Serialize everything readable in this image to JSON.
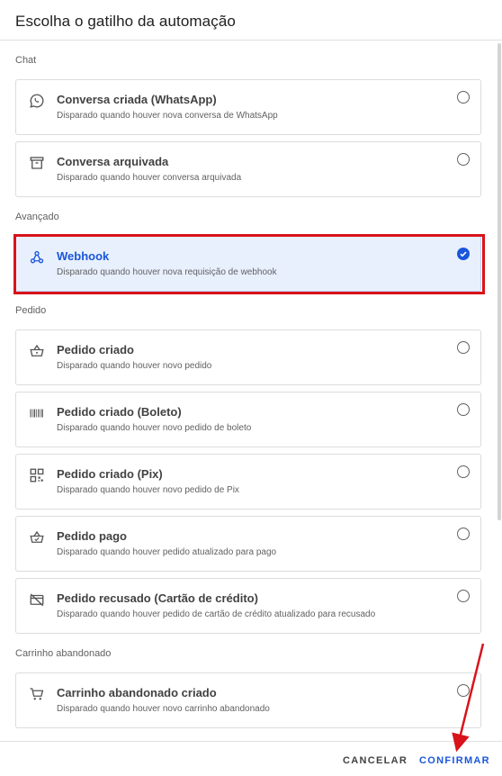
{
  "dialog": {
    "title": "Escolha o gatilho da automação",
    "sections": [
      {
        "label": "Chat",
        "items": [
          {
            "title": "Conversa criada (WhatsApp)",
            "description": "Disparado quando houver nova conversa de WhatsApp",
            "icon": "whatsapp-icon",
            "selected": false
          },
          {
            "title": "Conversa arquivada",
            "description": "Disparado quando houver conversa arquivada",
            "icon": "archive-icon",
            "selected": false
          }
        ]
      },
      {
        "label": "Avançado",
        "items": [
          {
            "title": "Webhook",
            "description": "Disparado quando houver nova requisição de webhook",
            "icon": "webhook-icon",
            "selected": true
          }
        ]
      },
      {
        "label": "Pedido",
        "items": [
          {
            "title": "Pedido criado",
            "description": "Disparado quando houver novo pedido",
            "icon": "basket-icon",
            "selected": false
          },
          {
            "title": "Pedido criado (Boleto)",
            "description": "Disparado quando houver novo pedido de boleto",
            "icon": "barcode-icon",
            "selected": false
          },
          {
            "title": "Pedido criado (Pix)",
            "description": "Disparado quando houver novo pedido de Pix",
            "icon": "qrcode-icon",
            "selected": false
          },
          {
            "title": "Pedido pago",
            "description": "Disparado quando houver pedido atualizado para pago",
            "icon": "basket-check-icon",
            "selected": false
          },
          {
            "title": "Pedido recusado (Cartão de crédito)",
            "description": "Disparado quando houver pedido de cartão de crédito atualizado para recusado",
            "icon": "credit-card-off-icon",
            "selected": false
          }
        ]
      },
      {
        "label": "Carrinho abandonado",
        "items": [
          {
            "title": "Carrinho abandonado criado",
            "description": "Disparado quando houver novo carrinho abandonado",
            "icon": "cart-icon",
            "selected": false
          }
        ]
      }
    ]
  },
  "footer": {
    "cancel_label": "CANCELAR",
    "confirm_label": "CONFIRMAR"
  },
  "colors": {
    "accent": "#1a56db",
    "selected_bg": "#e8f0fe",
    "annotation_red": "#d8131b"
  }
}
